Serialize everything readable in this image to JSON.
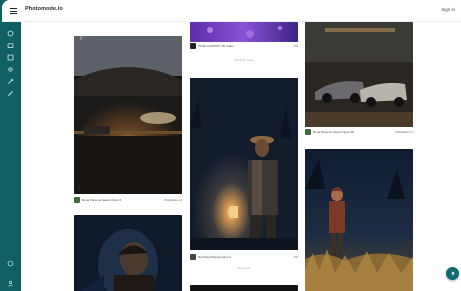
{
  "app": {
    "title": "Photomode.io",
    "signin_label": "Sign in"
  },
  "sidebar": {
    "icons": [
      "home-icon",
      "camera-icon",
      "image-icon",
      "gear-icon",
      "wrench-icon",
      "pencil-icon",
      "circle-icon",
      "user-icon"
    ]
  },
  "feed": {
    "col1": {
      "card1": {
        "author": "Rena Parsons Steam Open 6",
        "platform": "PlayStation 4"
      }
    },
    "col2": {
      "card0": {
        "author": "PIXEL FANTASY 2D Video",
        "platform": "PS"
      },
      "load_more_1": "Scroll for more",
      "card1": {
        "author": "Red Dead Redemption 2",
        "platform": "PS"
      },
      "load_more_2": "Sort more"
    },
    "col3": {
      "card0": {
        "author": "Rena Parsons Steam Open 18",
        "platform": "PlayStation 4"
      }
    }
  },
  "fab": {
    "icon": "arrow-up-icon"
  },
  "colors": {
    "brand": "#0f5f63",
    "fab": "#0f6b70"
  }
}
